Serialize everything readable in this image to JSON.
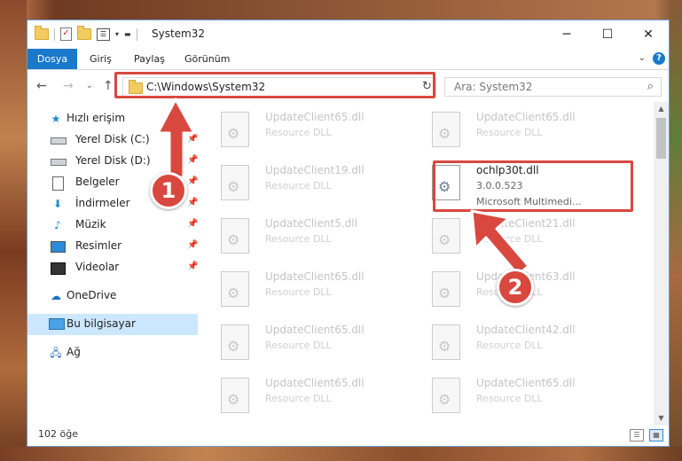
{
  "window": {
    "title": "System32",
    "controls": [
      "─",
      "☐",
      "✕"
    ]
  },
  "ribbon": {
    "tabs": [
      "Dosya",
      "Giriş",
      "Paylaş",
      "Görünüm"
    ],
    "help": "?"
  },
  "address": {
    "path": "C:\\Windows\\System32",
    "search_placeholder": "Ara: System32"
  },
  "sidebar": {
    "items": [
      {
        "label": "Hızlı erişim",
        "icon": "star-icon",
        "pinned": false
      },
      {
        "label": "Yerel Disk (C:)",
        "icon": "drive-icon",
        "pinned": true
      },
      {
        "label": "Yerel Disk (D:)",
        "icon": "drive-icon",
        "pinned": true
      },
      {
        "label": "Belgeler",
        "icon": "document-icon",
        "pinned": true
      },
      {
        "label": "İndirmeler",
        "icon": "download-icon",
        "pinned": true
      },
      {
        "label": "Müzik",
        "icon": "music-icon",
        "pinned": true
      },
      {
        "label": "Resimler",
        "icon": "pictures-icon",
        "pinned": true
      },
      {
        "label": "Videolar",
        "icon": "videos-icon",
        "pinned": true
      },
      {
        "label": "OneDrive",
        "icon": "cloud-icon",
        "pinned": false
      },
      {
        "label": "Bu bilgisayar",
        "icon": "computer-icon",
        "pinned": false,
        "selected": true
      },
      {
        "label": "Ağ",
        "icon": "network-icon",
        "pinned": false
      }
    ]
  },
  "files": [
    {
      "name": "UpdateClient65.dll",
      "desc": "Resource DLL"
    },
    {
      "name": "UpdateClient65.dll",
      "desc": "Resource DLL"
    },
    {
      "name": "UpdateClient19.dll",
      "desc": "Resource DLL"
    },
    {
      "name": "ochlp30t.dll",
      "version": "3.0.0.523",
      "desc": "Microsoft Multimedi...",
      "highlighted": true
    },
    {
      "name": "UpdateClient5.dll",
      "desc": "Resource DLL"
    },
    {
      "name": "UpdateClient21.dll",
      "desc": "Resource DLL"
    },
    {
      "name": "UpdateClient65.dll",
      "desc": "Resource DLL"
    },
    {
      "name": "UpdateClient63.dll",
      "desc": "Resource DLL"
    },
    {
      "name": "UpdateClient65.dll",
      "desc": "Resource DLL"
    },
    {
      "name": "UpdateClient42.dll",
      "desc": "Resource DLL"
    },
    {
      "name": "UpdateClient65.dll",
      "desc": "Resource DLL"
    },
    {
      "name": "UpdateClient65.dll",
      "desc": "Resource DLL"
    }
  ],
  "status": {
    "count_text": "102 öğe"
  },
  "annotations": {
    "badge_1": "1",
    "badge_2": "2",
    "accent_color": "#d9483f"
  }
}
